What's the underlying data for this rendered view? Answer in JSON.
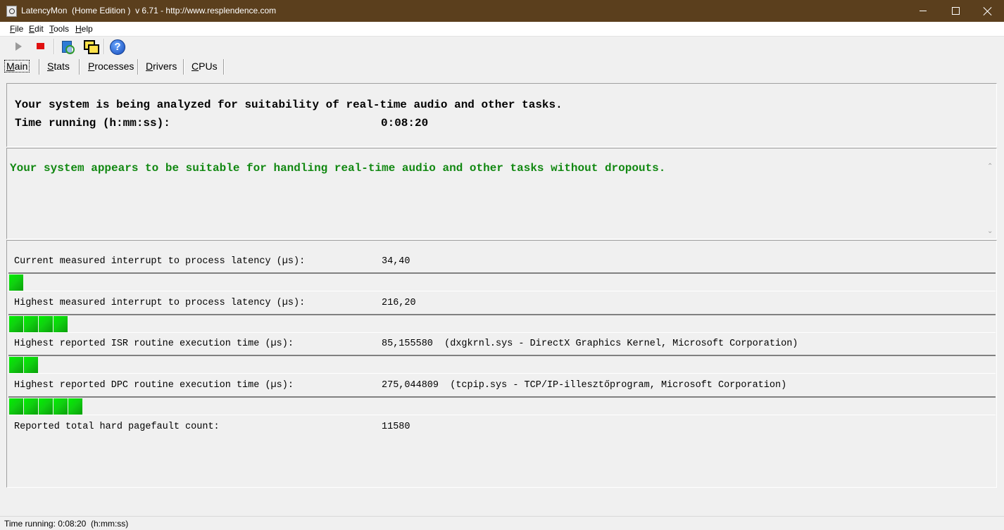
{
  "window": {
    "title": "LatencyMon  (Home Edition )  v 6.71 - http://www.resplendence.com"
  },
  "menu": {
    "file": {
      "u": "F",
      "rest": "ile"
    },
    "edit": {
      "u": "E",
      "rest": "dit"
    },
    "tools": {
      "u": "T",
      "rest": "ools"
    },
    "help": {
      "u": "H",
      "rest": "elp"
    }
  },
  "toolbar": {
    "help_glyph": "?"
  },
  "tabs": {
    "main": {
      "u": "M",
      "rest": "ain"
    },
    "stats": {
      "u": "S",
      "rest": "tats"
    },
    "processes": {
      "u": "P",
      "rest": "rocesses"
    },
    "drivers": {
      "u": "D",
      "rest": "rivers"
    },
    "cpus": {
      "u": "C",
      "rest": "PUs"
    }
  },
  "analysis": {
    "status_line": "Your system is being analyzed for suitability of real-time audio and other tasks.",
    "time_label": "Time running (h:mm:ss):",
    "time_value": "0:08:20"
  },
  "verdict": {
    "text": "Your system appears to be suitable for handling real-time audio and other tasks without dropouts.",
    "color": "#118811"
  },
  "metrics": [
    {
      "label": "Current measured interrupt to process latency (µs):",
      "value": "34,40",
      "bar_segments": 1
    },
    {
      "label": "Highest measured interrupt to process latency (µs):",
      "value": "216,20",
      "bar_segments": 4
    },
    {
      "label": "Highest reported ISR routine execution time (µs):",
      "value": "85,155580  (dxgkrnl.sys - DirectX Graphics Kernel, Microsoft Corporation)",
      "bar_segments": 2
    },
    {
      "label": "Highest reported DPC routine execution time (µs):",
      "value": "275,044809  (tcpip.sys - TCP/IP-illesztőprogram, Microsoft Corporation)",
      "bar_segments": 5
    },
    {
      "label": "Reported total hard pagefault count:",
      "value": "11580"
    }
  ],
  "statusbar": {
    "text": "Time running: 0:08:20  (h:mm:ss)"
  }
}
